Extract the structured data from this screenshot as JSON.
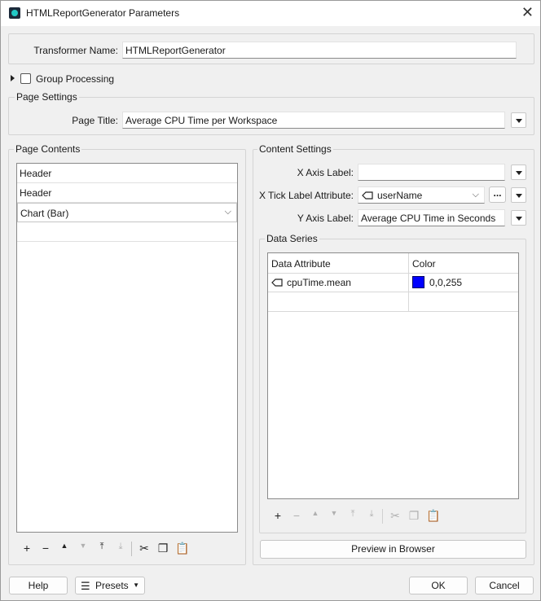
{
  "window": {
    "title": "HTMLReportGenerator Parameters",
    "close_icon": "close-icon"
  },
  "transformer": {
    "label": "Transformer Name:",
    "value": "HTMLReportGenerator"
  },
  "group_processing": {
    "label": "Group Processing",
    "checked": false
  },
  "page_settings": {
    "title": "Page Settings",
    "page_title_label": "Page Title:",
    "page_title_value": "Average CPU Time per Workspace"
  },
  "page_contents": {
    "title": "Page Contents",
    "items": [
      "Header",
      "Header",
      "Chart (Bar)",
      ""
    ]
  },
  "content_settings": {
    "title": "Content Settings",
    "x_axis_label": "X Axis Label:",
    "x_axis_value": "",
    "x_tick_label": "X Tick Label Attribute:",
    "x_tick_value": "userName",
    "ellipsis": "...",
    "y_axis_label": "Y Axis Label:",
    "y_axis_value": "Average CPU Time in Seconds"
  },
  "data_series": {
    "title": "Data Series",
    "columns": [
      "Data Attribute",
      "Color"
    ],
    "rows": [
      {
        "attribute": "cpuTime.mean",
        "color_text": "0,0,255",
        "color_hex": "#0000ff"
      }
    ]
  },
  "buttons": {
    "preview": "Preview in Browser",
    "help": "Help",
    "presets": "Presets",
    "ok": "OK",
    "cancel": "Cancel"
  }
}
